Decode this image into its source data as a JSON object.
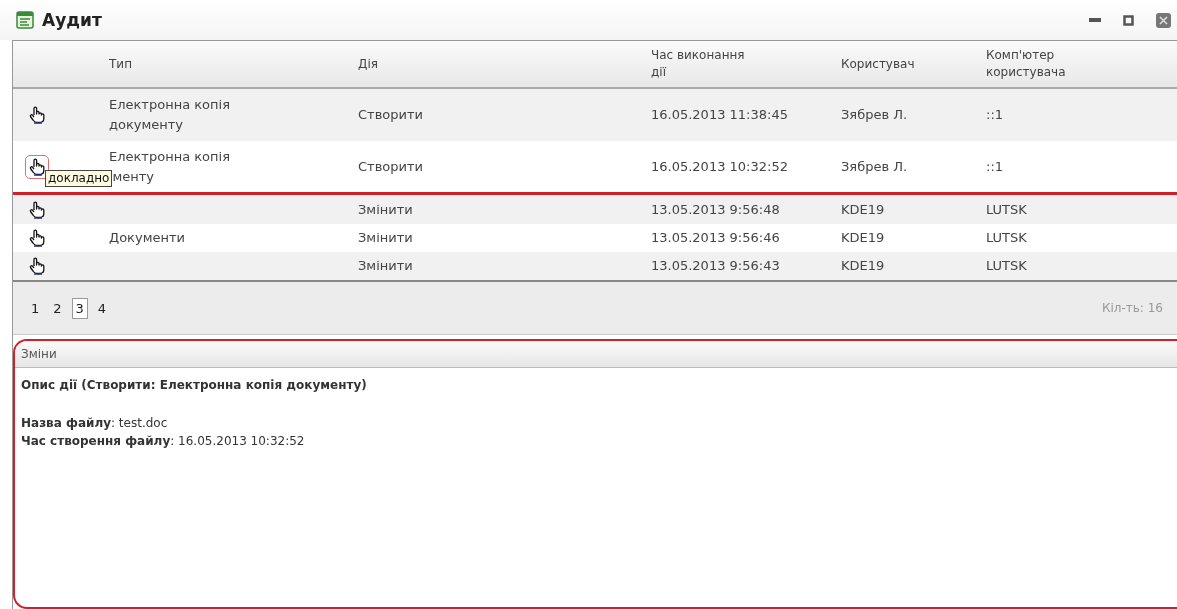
{
  "window": {
    "title": "Аудит"
  },
  "table": {
    "columns": [
      "",
      "Тип",
      "Дія",
      "Час виконання дії",
      "Користувач",
      "Комп'ютер користувача"
    ],
    "rows": [
      {
        "type_lines": [
          "Електронна копія",
          "документу"
        ],
        "action": "Створити",
        "time": "16.05.2013 11:38:45",
        "user": "Зябрев Л.",
        "computer": "::1",
        "marked": false
      },
      {
        "type_lines": [
          "Електронна копія",
          "менту"
        ],
        "action": "Створити",
        "time": "16.05.2013 10:32:52",
        "user": "Зябрев Л.",
        "computer": "::1",
        "marked": true,
        "tooltip": "докладно"
      },
      {
        "type_lines": [],
        "action": "Змінити",
        "time": "13.05.2013 9:56:48",
        "user": "KDE19",
        "computer": "LUTSK",
        "marked": false
      },
      {
        "type_lines": [
          "Документи"
        ],
        "action": "Змінити",
        "time": "13.05.2013 9:56:46",
        "user": "KDE19",
        "computer": "LUTSK",
        "marked": false
      },
      {
        "type_lines": [],
        "action": "Змінити",
        "time": "13.05.2013 9:56:43",
        "user": "KDE19",
        "computer": "LUTSK",
        "marked": false
      }
    ]
  },
  "pagination": {
    "pages": [
      {
        "label": "1",
        "selected": false
      },
      {
        "label": "2",
        "selected": false
      },
      {
        "label": "3",
        "selected": true
      },
      {
        "label": "4",
        "selected": false
      }
    ],
    "count": "Кіл-ть: 16"
  },
  "details": {
    "title": "Зміни",
    "marked": true,
    "heading": "Опис дії (Створити: Електронна копія документу)",
    "fields": [
      {
        "label": "Назва файлу",
        "value": ": test.doc"
      },
      {
        "label": "Час створення файлу",
        "value": ": 16.05.2013 10:32:52"
      }
    ]
  }
}
